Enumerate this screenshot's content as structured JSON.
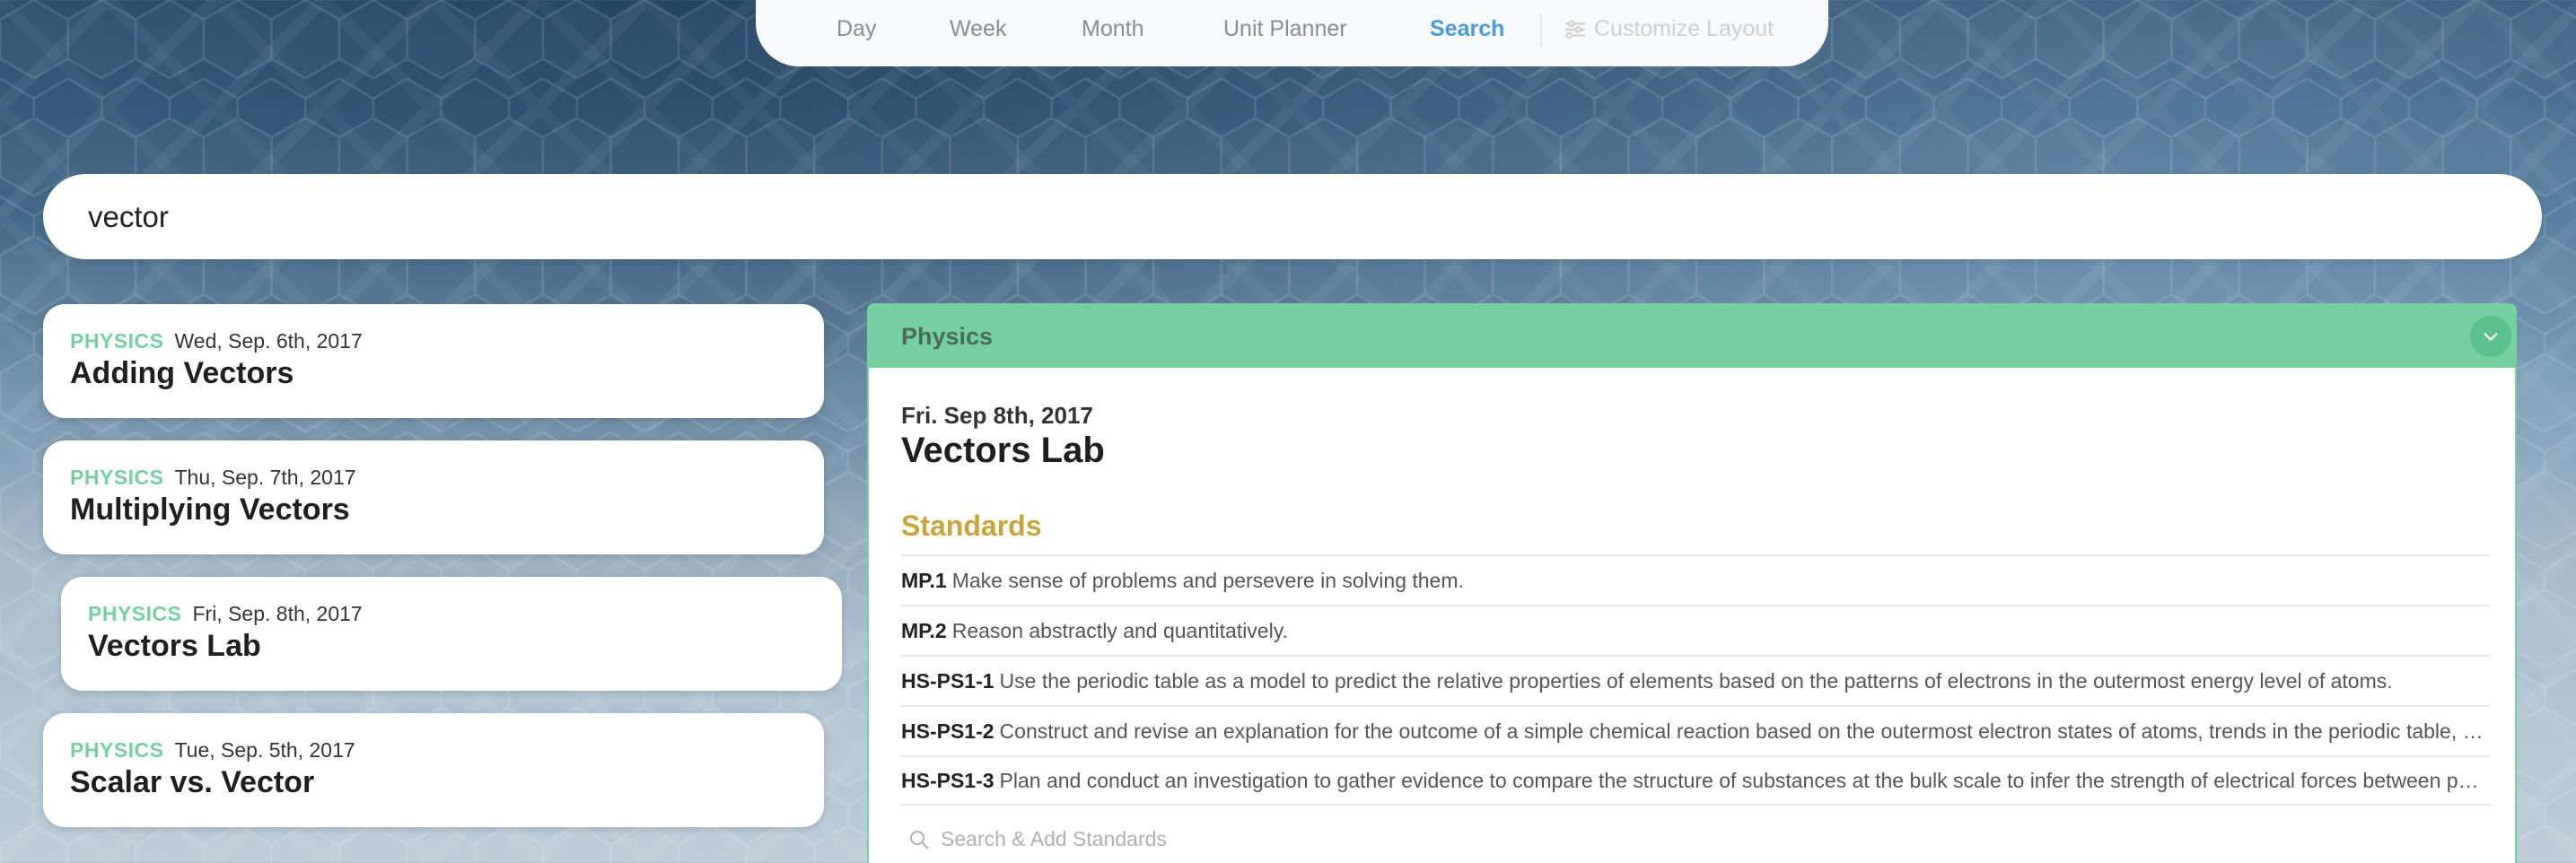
{
  "nav": {
    "items": [
      {
        "label": "Day",
        "active": false
      },
      {
        "label": "Week",
        "active": false
      },
      {
        "label": "Month",
        "active": false
      },
      {
        "label": "Unit Planner",
        "active": false
      },
      {
        "label": "Search",
        "active": true
      }
    ],
    "customize_label": "Customize Layout",
    "customize_icon": "sliders-icon"
  },
  "search": {
    "value": "vector"
  },
  "results": [
    {
      "subject": "PHYSICS",
      "date": "Wed, Sep. 6th, 2017",
      "title": "Adding Vectors",
      "selected": false
    },
    {
      "subject": "PHYSICS",
      "date": "Thu, Sep. 7th, 2017",
      "title": "Multiplying Vectors",
      "selected": false
    },
    {
      "subject": "PHYSICS",
      "date": "Fri, Sep. 8th, 2017",
      "title": "Vectors Lab",
      "selected": true
    },
    {
      "subject": "PHYSICS",
      "date": "Tue, Sep. 5th, 2017",
      "title": "Scalar vs. Vector",
      "selected": false
    }
  ],
  "detail": {
    "subject": "Physics",
    "date": "Fri. Sep 8th, 2017",
    "title": "Vectors Lab",
    "standards_heading": "Standards",
    "standards": [
      {
        "code": "MP.1",
        "text": "Make sense of problems and persevere in solving them."
      },
      {
        "code": "MP.2",
        "text": "Reason abstractly and quantitatively."
      },
      {
        "code": "HS-PS1-1",
        "text": "Use the periodic table as a model to predict the relative properties of elements based on the patterns of electrons in the outermost energy level of atoms."
      },
      {
        "code": "HS-PS1-2",
        "text": "Construct and revise an explanation for the outcome of a simple chemical reaction based on the outermost electron states of atoms, trends in the periodic table, and …"
      },
      {
        "code": "HS-PS1-3",
        "text": "Plan and conduct an investigation to gather evidence to compare the structure of substances at the bulk scale to infer the strength of electrical forces between particl…"
      }
    ],
    "standards_search_placeholder": "Search & Add Standards"
  },
  "colors": {
    "accent_green": "#76cfa0",
    "active_nav_blue": "#4b9bd8",
    "standards_gold": "#c9a43a"
  }
}
